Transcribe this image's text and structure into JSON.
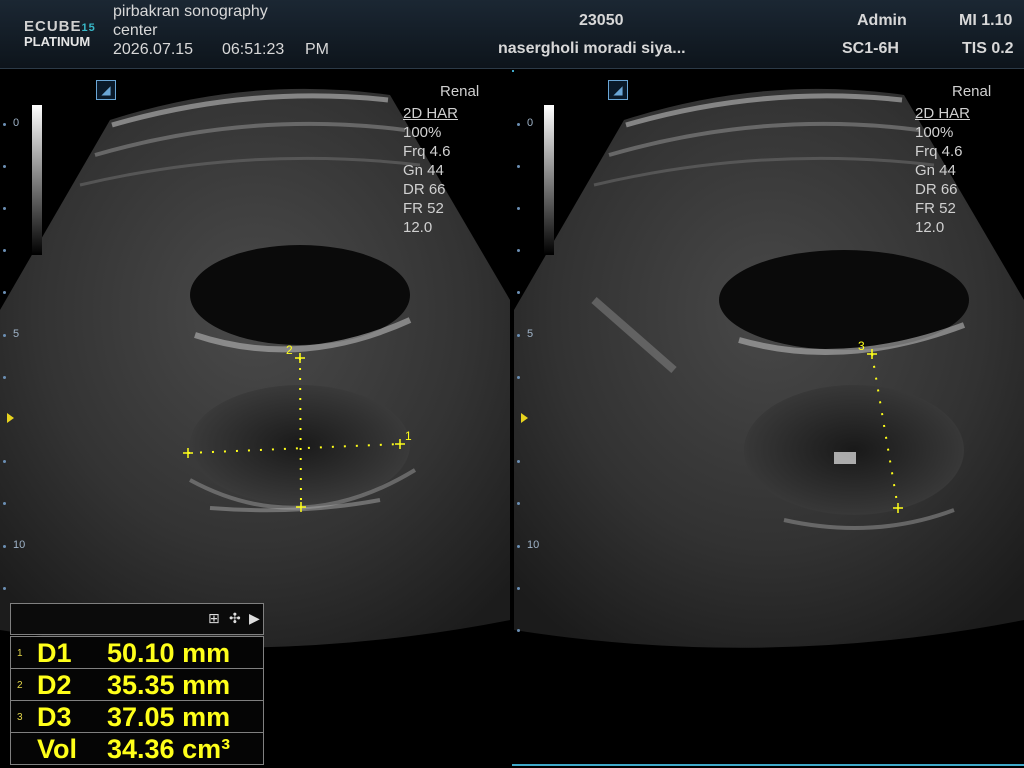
{
  "header": {
    "logo_line1": "ECUBE",
    "logo_line1_num": "15",
    "logo_line2": "PLATINUM",
    "institution_line1": "pirbakran sonography",
    "institution_line2": "center",
    "date": "2026.07.15",
    "time": "06:51:23",
    "ampm": "PM",
    "patient_id": "23050",
    "patient_name": "nasergholi moradi siya...",
    "operator": "Admin",
    "probe": "SC1-6H",
    "mi": "MI 1.10",
    "tis": "TIS 0.2"
  },
  "image_params": {
    "preset": "Renal",
    "mode": "2D HAR",
    "power": "100%",
    "frequency": "Frq 4.6",
    "gain": "Gn 44",
    "dynamic_range": "DR 66",
    "frame_rate": "FR 52",
    "depth": "12.0"
  },
  "depth_scale": {
    "mark_0": "0",
    "mark_5": "5",
    "mark_10": "10"
  },
  "calipers": {
    "left": [
      "1",
      "2"
    ],
    "right": [
      "3"
    ]
  },
  "measurements": {
    "rows": [
      {
        "index": "1",
        "label": "D1",
        "value": "50.10 mm"
      },
      {
        "index": "2",
        "label": "D2",
        "value": "35.35 mm"
      },
      {
        "index": "3",
        "label": "D3",
        "value": "37.05 mm"
      },
      {
        "index": "",
        "label": "Vol",
        "value": "34.36 cm³"
      }
    ],
    "controls": {
      "grid": "⊞",
      "move": "✣",
      "collapse": "▶"
    }
  },
  "colors": {
    "accent": "#3fa9c9",
    "caliper": "#ffff1a",
    "header_bg": "#1b2733"
  },
  "icons": {
    "probe_orientation": "probe-orientation-icon"
  }
}
